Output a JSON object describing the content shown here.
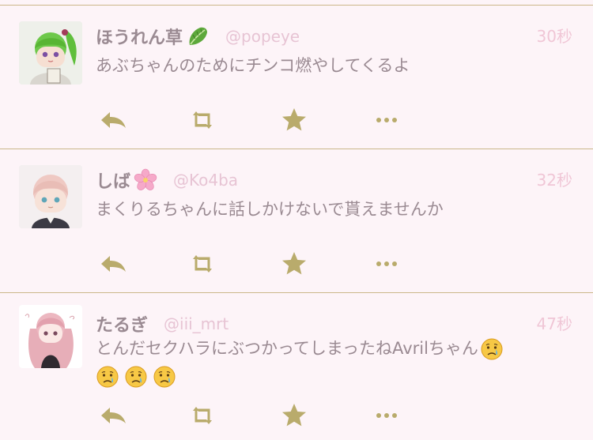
{
  "colors": {
    "background": "#fdf4f8",
    "divider": "#cbb78a",
    "name": "#9a8a92",
    "handle": "#e7c4d4",
    "timestamp": "#f0c6d6",
    "action_icon": "#b9ab6c"
  },
  "tweets": [
    {
      "display_name": "ほうれん草",
      "name_emoji": "leafy-green-emoji",
      "handle": "@popeye",
      "time": "30秒",
      "lines": [
        {
          "text": "あぶちゃんのためにチンコ燃やしてくるよ"
        }
      ],
      "actions": [
        "reply-icon",
        "retweet-icon",
        "star-icon",
        "more-icon"
      ]
    },
    {
      "display_name": "しば",
      "name_emoji": "cherry-blossom-emoji",
      "handle": "@Ko4ba",
      "time": "32秒",
      "lines": [
        {
          "text": "まくりるちゃんに話しかけないで貰えませんか"
        }
      ],
      "actions": [
        "reply-icon",
        "retweet-icon",
        "star-icon",
        "more-icon"
      ]
    },
    {
      "display_name": "たるぎ",
      "handle": "@iii_mrt",
      "time": "47秒",
      "lines": [
        {
          "text": "とんだセクハラにぶつかってしまったねAvrilちゃん",
          "trailing_emoji": "crying-face-emoji"
        },
        {
          "emojis": [
            "crying-face-emoji",
            "crying-face-emoji",
            "crying-face-emoji"
          ]
        }
      ],
      "actions": [
        "reply-icon",
        "retweet-icon",
        "star-icon",
        "more-icon"
      ]
    }
  ]
}
